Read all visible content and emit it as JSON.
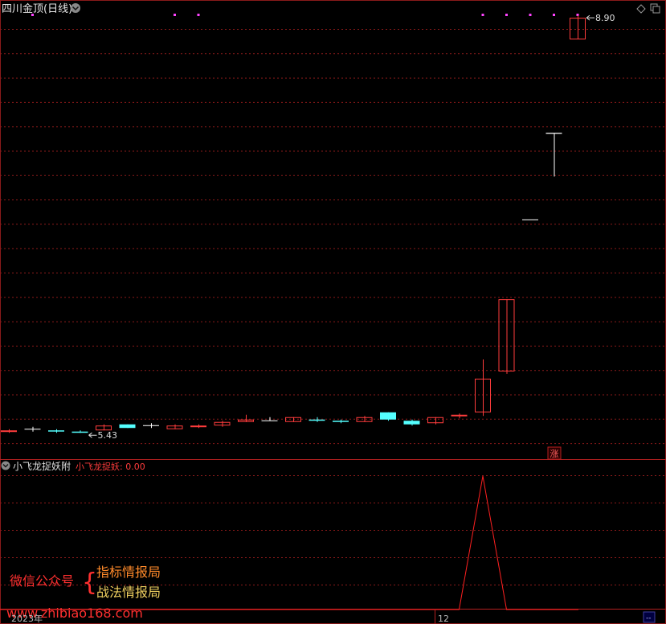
{
  "header": {
    "stock_title": "四川金顶(日线)",
    "sub_indicator_name": "小飞龙捉妖附",
    "sub_indicator_value": "小飞龙捉妖: 0.00",
    "zhang_badge": "涨"
  },
  "watermark": {
    "wechat_label": "微信公众号",
    "brace": "{",
    "line1": "指标情报局",
    "line2": "战法情报局",
    "site": "www.zhibiao168.com"
  },
  "footer": {
    "label_year": "2023年",
    "label_month": "12",
    "corner_text": "--"
  },
  "colors": {
    "up": "#ff3c3c",
    "down": "#54ffff",
    "flat": "#ffffff",
    "grid": "#8a1a1a",
    "signal_dot": "#ff44ff",
    "indicator_line": "#ff2020"
  },
  "chart_data": {
    "type": "candlestick",
    "title": "四川金顶(日线)",
    "annotations": [
      {
        "text": "5.43",
        "candle": 3,
        "kind": "low"
      },
      {
        "text": "8.90",
        "candle": 24,
        "kind": "high"
      }
    ],
    "candles": [
      {
        "o": 5.44,
        "h": 5.46,
        "l": 5.43,
        "c": 5.45,
        "color": "up"
      },
      {
        "o": 5.46,
        "h": 5.48,
        "l": 5.44,
        "c": 5.46,
        "color": "flat"
      },
      {
        "o": 5.45,
        "h": 5.46,
        "l": 5.43,
        "c": 5.44,
        "color": "down"
      },
      {
        "o": 5.44,
        "h": 5.45,
        "l": 5.43,
        "c": 5.43,
        "color": "down"
      },
      {
        "o": 5.45,
        "h": 5.5,
        "l": 5.45,
        "c": 5.49,
        "color": "up"
      },
      {
        "o": 5.5,
        "h": 5.5,
        "l": 5.47,
        "c": 5.47,
        "color": "down"
      },
      {
        "o": 5.49,
        "h": 5.51,
        "l": 5.47,
        "c": 5.49,
        "color": "flat"
      },
      {
        "o": 5.46,
        "h": 5.5,
        "l": 5.46,
        "c": 5.49,
        "color": "up"
      },
      {
        "o": 5.49,
        "h": 5.5,
        "l": 5.47,
        "c": 5.49,
        "color": "up"
      },
      {
        "o": 5.49,
        "h": 5.53,
        "l": 5.48,
        "c": 5.52,
        "color": "up"
      },
      {
        "o": 5.52,
        "h": 5.58,
        "l": 5.52,
        "c": 5.54,
        "color": "up"
      },
      {
        "o": 5.53,
        "h": 5.56,
        "l": 5.53,
        "c": 5.53,
        "color": "flat"
      },
      {
        "o": 5.52,
        "h": 5.56,
        "l": 5.52,
        "c": 5.56,
        "color": "up"
      },
      {
        "o": 5.54,
        "h": 5.56,
        "l": 5.52,
        "c": 5.54,
        "color": "down"
      },
      {
        "o": 5.53,
        "h": 5.54,
        "l": 5.51,
        "c": 5.52,
        "color": "down"
      },
      {
        "o": 5.52,
        "h": 5.57,
        "l": 5.52,
        "c": 5.56,
        "color": "up"
      },
      {
        "o": 5.6,
        "h": 5.6,
        "l": 5.53,
        "c": 5.54,
        "color": "down"
      },
      {
        "o": 5.53,
        "h": 5.54,
        "l": 5.49,
        "c": 5.5,
        "color": "down"
      },
      {
        "o": 5.51,
        "h": 5.56,
        "l": 5.5,
        "c": 5.56,
        "color": "up"
      },
      {
        "o": 5.57,
        "h": 5.59,
        "l": 5.55,
        "c": 5.58,
        "color": "up"
      },
      {
        "o": 5.6,
        "h": 6.04,
        "l": 5.57,
        "c": 5.88,
        "color": "up"
      },
      {
        "o": 5.94,
        "h": 6.54,
        "l": 5.92,
        "c": 6.54,
        "color": "up"
      },
      {
        "o": 7.2,
        "h": 7.2,
        "l": 7.2,
        "c": 7.2,
        "color": "flat"
      },
      {
        "o": 7.92,
        "h": 7.92,
        "l": 7.56,
        "c": 7.92,
        "color": "flat"
      },
      {
        "o": 8.7,
        "h": 8.9,
        "l": 8.7,
        "c": 8.88,
        "color": "up"
      }
    ],
    "signal_markers": [
      1,
      7,
      8,
      20,
      21,
      22,
      23,
      24
    ],
    "indicator": {
      "name": "小飞龙捉妖",
      "values": [
        0,
        0,
        0,
        0,
        0,
        0,
        0,
        0,
        0,
        0,
        0,
        0,
        0,
        0,
        0,
        0,
        0,
        0,
        0,
        0,
        1,
        0,
        0,
        0,
        0
      ]
    }
  }
}
